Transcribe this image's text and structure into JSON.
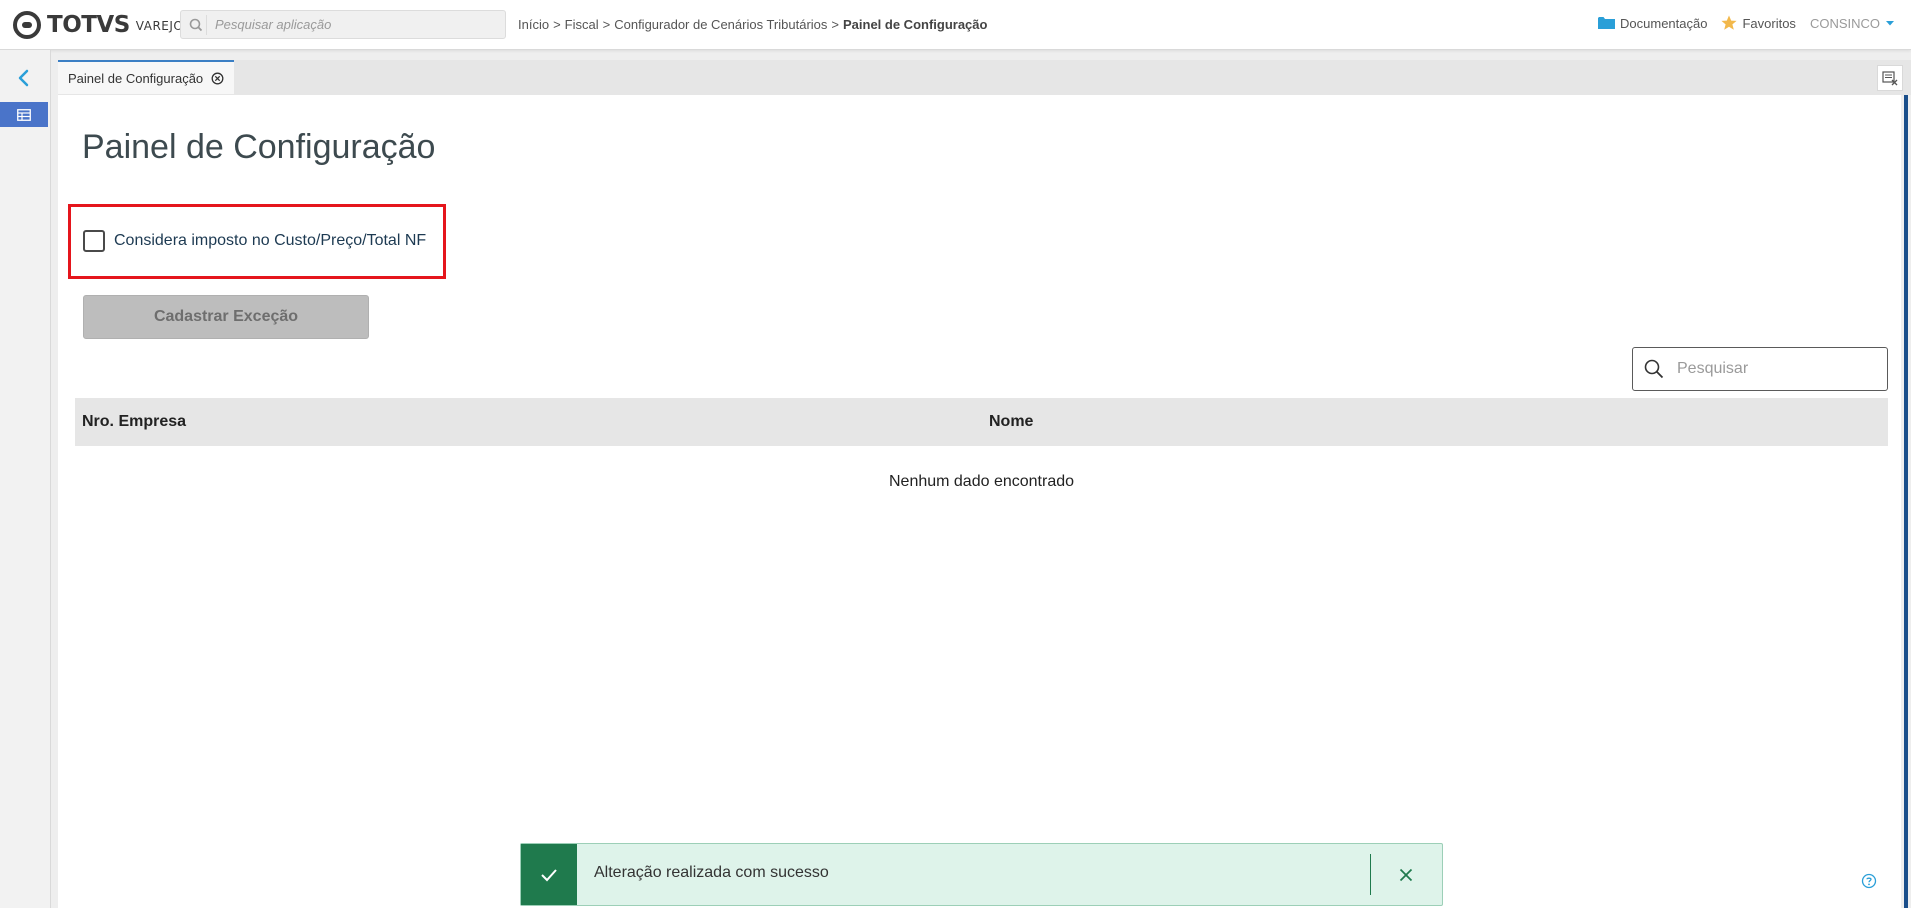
{
  "header": {
    "logo": {
      "brand": "TOTVS",
      "product": "VAREJO"
    },
    "app_search": {
      "placeholder": "Pesquisar aplicação"
    },
    "breadcrumb": {
      "items": [
        "Início",
        "Fiscal",
        "Configurador de Cenários Tributários"
      ],
      "current": "Painel de Configuração",
      "separator": ">"
    },
    "links": {
      "documentation": "Documentação",
      "favorites": "Favoritos",
      "user": "CONSINCO"
    }
  },
  "sidebar": {
    "collapse_icon": "chevron-left-icon",
    "active_item_icon": "table-icon"
  },
  "tabs": [
    {
      "label": "Painel de Configuração",
      "active": true
    }
  ],
  "page": {
    "title": "Painel de Configuração",
    "checkbox": {
      "label": "Considera imposto no Custo/Preço/Total NF",
      "checked": false
    },
    "button_cadastrar": "Cadastrar Exceção",
    "table_search": {
      "placeholder": "Pesquisar"
    },
    "table": {
      "columns": [
        "Nro. Empresa",
        "Nome"
      ],
      "rows": [],
      "empty_message": "Nenhum dado encontrado"
    }
  },
  "toast": {
    "type": "success",
    "message": "Alteração realizada com sucesso"
  },
  "colors": {
    "accent": "#3b7fc4",
    "sidebar_active": "#4a74c9",
    "highlight": "#e5151c",
    "toast_success": "#1f7a4d",
    "favorites_star": "#f2b84b"
  }
}
